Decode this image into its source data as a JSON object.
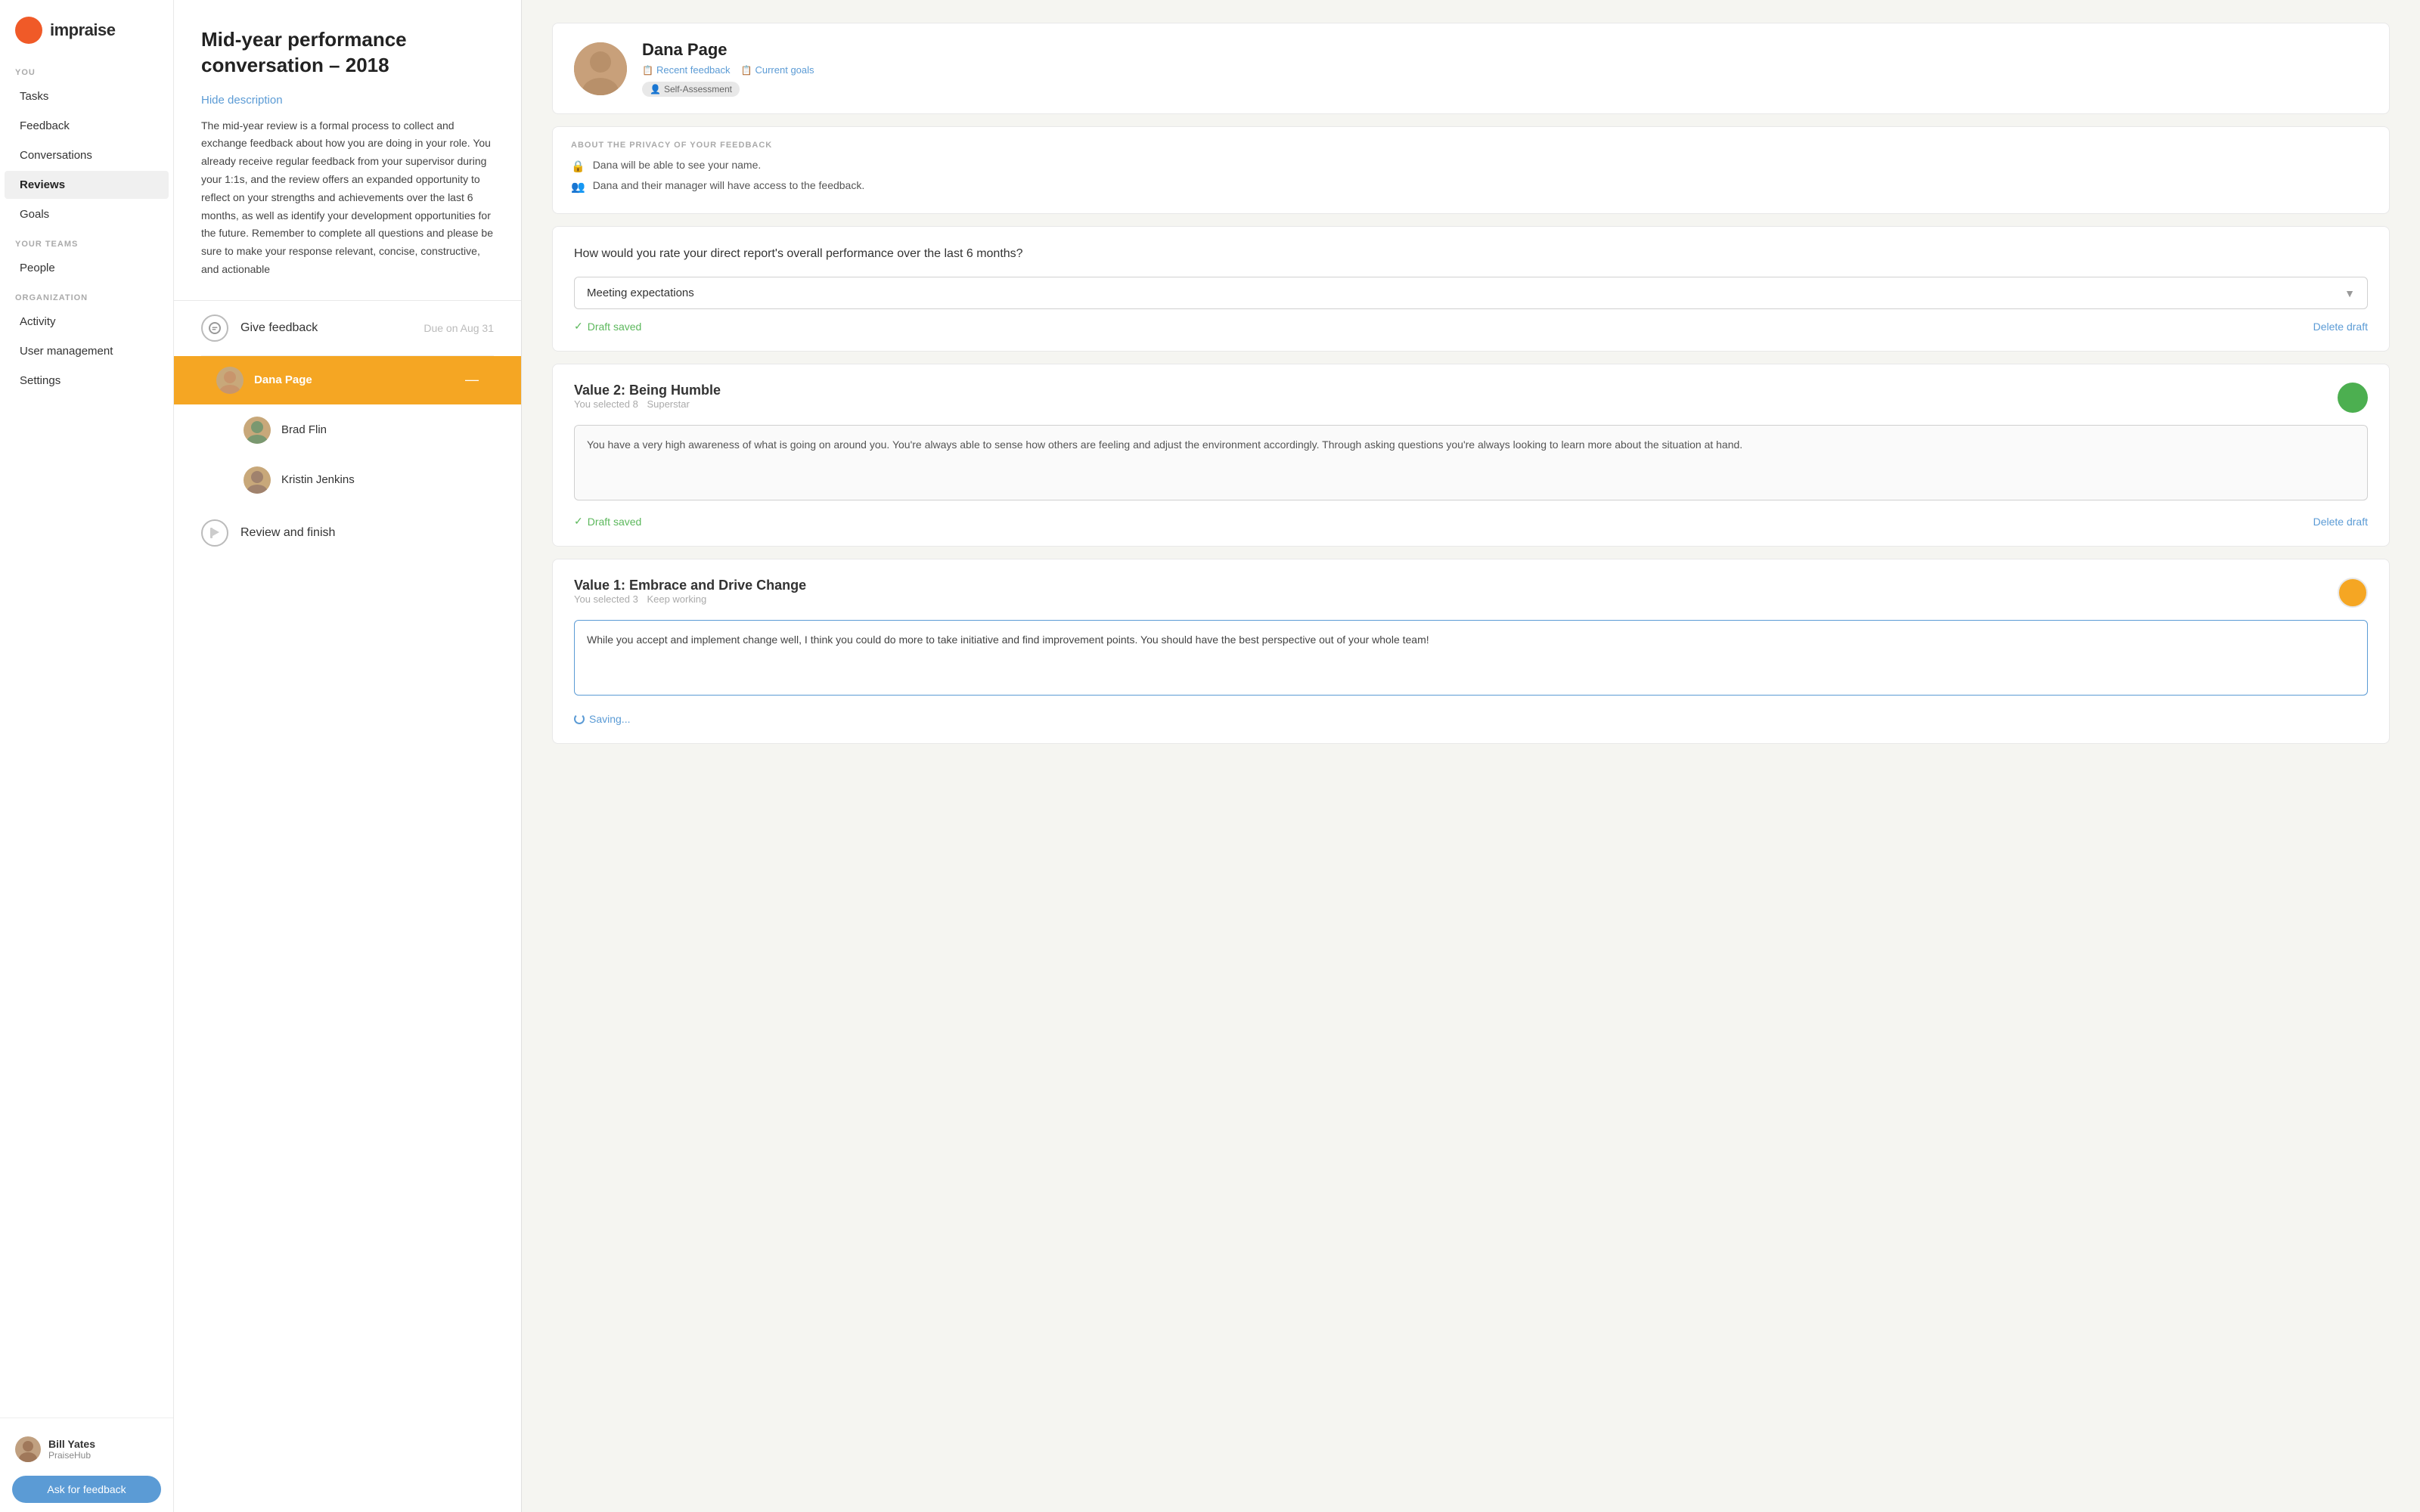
{
  "sidebar": {
    "logo": {
      "text": "impraise"
    },
    "sections": [
      {
        "label": "YOU",
        "items": [
          {
            "id": "tasks",
            "label": "Tasks",
            "active": false
          },
          {
            "id": "feedback",
            "label": "Feedback",
            "active": false
          },
          {
            "id": "conversations",
            "label": "Conversations",
            "active": false
          },
          {
            "id": "reviews",
            "label": "Reviews",
            "active": true
          },
          {
            "id": "goals",
            "label": "Goals",
            "active": false
          }
        ]
      },
      {
        "label": "YOUR TEAMS",
        "items": [
          {
            "id": "people",
            "label": "People",
            "active": false
          }
        ]
      },
      {
        "label": "ORGANIZATION",
        "items": [
          {
            "id": "activity",
            "label": "Activity",
            "active": false
          },
          {
            "id": "user-management",
            "label": "User management",
            "active": false
          },
          {
            "id": "settings",
            "label": "Settings",
            "active": false
          }
        ]
      }
    ],
    "user": {
      "name": "Bill Yates",
      "org": "PraiseHub"
    },
    "ask_feedback_label": "Ask for feedback"
  },
  "conversation": {
    "title": "Mid-year performance conversation – 2018",
    "hide_description_label": "Hide description",
    "description": "The mid-year review is a formal process to collect and exchange feedback about how you are doing in your role. You already receive regular feedback from your supervisor during your 1:1s, and the review offers an expanded opportunity to reflect on your strengths and achievements over the last 6 months, as well as identify your development opportunities for the future. Remember to complete all questions and please be sure to make your response relevant, concise, constructive, and actionable",
    "steps": {
      "give_feedback": {
        "label": "Give feedback",
        "due": "Due on Aug 31"
      },
      "people": [
        {
          "name": "Dana Page",
          "active": true
        },
        {
          "name": "Brad Flin",
          "active": false
        },
        {
          "name": "Kristin Jenkins",
          "active": false
        }
      ],
      "review_finish": {
        "label": "Review and finish"
      }
    }
  },
  "right_panel": {
    "person": {
      "name": "Dana Page",
      "recent_feedback_label": "Recent feedback",
      "current_goals_label": "Current goals",
      "self_assessment_label": "Self-Assessment"
    },
    "privacy": {
      "section_label": "ABOUT THE PRIVACY OF YOUR FEEDBACK",
      "items": [
        "Dana will be able to see your name.",
        "Dana and their manager will have access to the feedback."
      ]
    },
    "overall_question": {
      "text": "How would you rate your direct report's overall performance over the last 6 months?",
      "selected_value": "Meeting expectations",
      "draft_saved_label": "Draft saved",
      "delete_draft_label": "Delete draft"
    },
    "value2": {
      "title": "Value 2: Being Humble",
      "selected": "You selected 8",
      "rating_label": "Superstar",
      "feedback_text": "You have a very high awareness of what is going on around you. You're always able to sense how others are feeling and adjust the environment accordingly. Through asking questions you're always looking to learn more about the situation at hand.",
      "draft_saved_label": "Draft saved",
      "delete_draft_label": "Delete draft",
      "badge_color": "green"
    },
    "value1": {
      "title": "Value 1: Embrace and Drive Change",
      "selected": "You selected 3",
      "rating_label": "Keep working",
      "feedback_text": "While you accept and implement change well, I think you could do more to take initiative and find improvement points. You should have the best perspective out of your whole team!",
      "badge_color": "orange",
      "saving_label": "Saving..."
    }
  },
  "colors": {
    "accent_orange": "#f5a623",
    "accent_blue": "#5b9bd5",
    "green": "#4caf50",
    "sidebar_active_bg": "#f0f0f0"
  }
}
